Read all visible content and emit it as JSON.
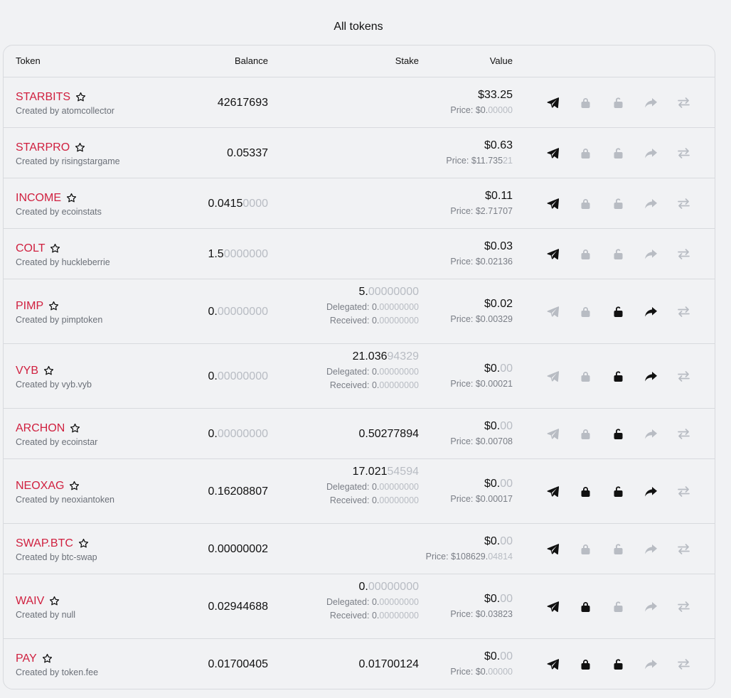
{
  "page": {
    "title": "All tokens"
  },
  "table": {
    "headers": {
      "token": "Token",
      "balance": "Balance",
      "stake": "Stake",
      "value": "Value"
    },
    "delegated_label": "Delegated: ",
    "received_label": "Received: ",
    "price_label": "Price: ",
    "rows": [
      {
        "name": "STARBITS",
        "creator": "Created by atomcollector",
        "balance": {
          "main": "42617693",
          "dim": ""
        },
        "stake": null,
        "value": {
          "main": "$33.25",
          "dim": ""
        },
        "price": {
          "main": "$0.",
          "dim": "00000"
        },
        "actions": {
          "transfer": true,
          "stake": false,
          "unstake": false,
          "delegate": false,
          "swap": false
        }
      },
      {
        "name": "STARPRO",
        "creator": "Created by risingstargame",
        "balance": {
          "main": "0.05337",
          "dim": ""
        },
        "stake": null,
        "value": {
          "main": "$0.63",
          "dim": ""
        },
        "price": {
          "main": "$11.735",
          "dim": "21"
        },
        "actions": {
          "transfer": true,
          "stake": false,
          "unstake": false,
          "delegate": false,
          "swap": false
        }
      },
      {
        "name": "INCOME",
        "creator": "Created by ecoinstats",
        "balance": {
          "main": "0.0415",
          "dim": "0000"
        },
        "stake": null,
        "value": {
          "main": "$0.11",
          "dim": ""
        },
        "price": {
          "main": "$2.71707",
          "dim": ""
        },
        "actions": {
          "transfer": true,
          "stake": false,
          "unstake": false,
          "delegate": false,
          "swap": false
        }
      },
      {
        "name": "COLT",
        "creator": "Created by huckleberrie",
        "balance": {
          "main": "1.5",
          "dim": "0000000"
        },
        "stake": null,
        "value": {
          "main": "$0.03",
          "dim": ""
        },
        "price": {
          "main": "$0.02136",
          "dim": ""
        },
        "actions": {
          "transfer": true,
          "stake": false,
          "unstake": false,
          "delegate": false,
          "swap": false
        }
      },
      {
        "name": "PIMP",
        "creator": "Created by pimptoken",
        "balance": {
          "main": "0.",
          "dim": "00000000"
        },
        "stake": {
          "main": "5.",
          "dim": "00000000",
          "delegated": {
            "main": "0.",
            "dim": "00000000"
          },
          "received": {
            "main": "0.",
            "dim": "00000000"
          }
        },
        "value": {
          "main": "$0.02",
          "dim": ""
        },
        "price": {
          "main": "$0.00329",
          "dim": ""
        },
        "actions": {
          "transfer": false,
          "stake": false,
          "unstake": true,
          "delegate": true,
          "swap": false
        }
      },
      {
        "name": "VYB",
        "creator": "Created by vyb.vyb",
        "balance": {
          "main": "0.",
          "dim": "00000000"
        },
        "stake": {
          "main": "21.036",
          "dim": "94329",
          "delegated": {
            "main": "0.",
            "dim": "00000000"
          },
          "received": {
            "main": "0.",
            "dim": "00000000"
          }
        },
        "value": {
          "main": "$0.",
          "dim": "00"
        },
        "price": {
          "main": "$0.00021",
          "dim": ""
        },
        "actions": {
          "transfer": false,
          "stake": false,
          "unstake": true,
          "delegate": true,
          "swap": false
        }
      },
      {
        "name": "ARCHON",
        "creator": "Created by ecoinstar",
        "balance": {
          "main": "0.",
          "dim": "00000000"
        },
        "stake": {
          "main": "0.50277894",
          "dim": ""
        },
        "value": {
          "main": "$0.",
          "dim": "00"
        },
        "price": {
          "main": "$0.00708",
          "dim": ""
        },
        "actions": {
          "transfer": false,
          "stake": false,
          "unstake": true,
          "delegate": false,
          "swap": false
        }
      },
      {
        "name": "NEOXAG",
        "creator": "Created by neoxiantoken",
        "balance": {
          "main": "0.16208807",
          "dim": ""
        },
        "stake": {
          "main": "17.021",
          "dim": "54594",
          "delegated": {
            "main": "0.",
            "dim": "00000000"
          },
          "received": {
            "main": "0.",
            "dim": "00000000"
          }
        },
        "value": {
          "main": "$0.",
          "dim": "00"
        },
        "price": {
          "main": "$0.00017",
          "dim": ""
        },
        "actions": {
          "transfer": true,
          "stake": true,
          "unstake": true,
          "delegate": true,
          "swap": false
        }
      },
      {
        "name": "SWAP.BTC",
        "creator": "Created by btc-swap",
        "balance": {
          "main": "0.00000002",
          "dim": ""
        },
        "stake": null,
        "value": {
          "main": "$0.",
          "dim": "00"
        },
        "price": {
          "main": "$108629.",
          "dim": "04814"
        },
        "actions": {
          "transfer": true,
          "stake": false,
          "unstake": false,
          "delegate": false,
          "swap": false
        }
      },
      {
        "name": "WAIV",
        "creator": "Created by null",
        "balance": {
          "main": "0.02944688",
          "dim": ""
        },
        "stake": {
          "main": "0.",
          "dim": "00000000",
          "delegated": {
            "main": "0.",
            "dim": "00000000"
          },
          "received": {
            "main": "0.",
            "dim": "00000000"
          }
        },
        "value": {
          "main": "$0.",
          "dim": "00"
        },
        "price": {
          "main": "$0.03823",
          "dim": ""
        },
        "actions": {
          "transfer": true,
          "stake": true,
          "unstake": false,
          "delegate": false,
          "swap": false
        }
      },
      {
        "name": "PAY",
        "creator": "Created by token.fee",
        "balance": {
          "main": "0.01700405",
          "dim": ""
        },
        "stake": {
          "main": "0.01700124",
          "dim": ""
        },
        "value": {
          "main": "$0.",
          "dim": "00"
        },
        "price": {
          "main": "$0.",
          "dim": "00000"
        },
        "actions": {
          "transfer": true,
          "stake": true,
          "unstake": true,
          "delegate": false,
          "swap": false
        }
      }
    ]
  },
  "icons": {
    "favorite": "star-outline-icon",
    "transfer": "paper-plane-icon",
    "stake": "lock-icon",
    "unstake": "unlock-icon",
    "delegate": "share-arrow-icon",
    "swap": "swap-arrows-icon"
  },
  "colors": {
    "token_name": "#d0203f",
    "active_icon": "#111111",
    "inactive_icon": "#b8bcc3",
    "dim_digits": "#b8bcc3"
  }
}
